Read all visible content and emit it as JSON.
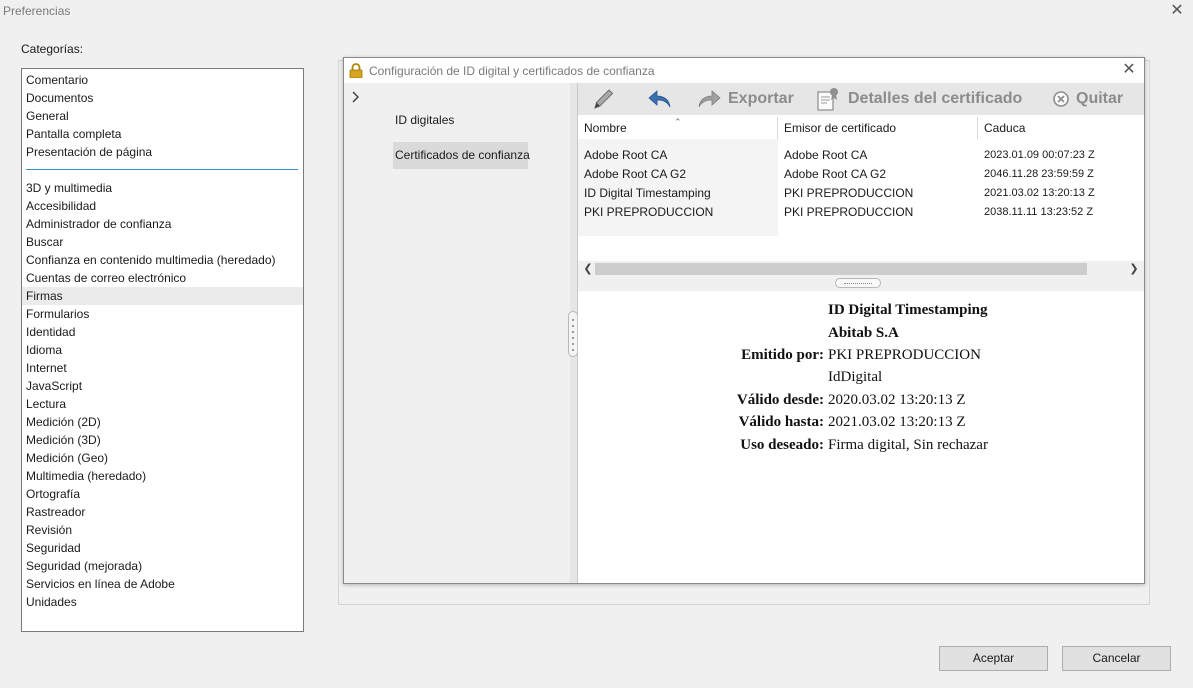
{
  "window": {
    "title": "Preferencias"
  },
  "categories": {
    "label": "Categorías:",
    "group1": [
      "Comentario",
      "Documentos",
      "General",
      "Pantalla completa",
      "Presentación de página"
    ],
    "group2": [
      "3D y multimedia",
      "Accesibilidad",
      "Administrador de confianza",
      "Buscar",
      "Confianza en contenido multimedia (heredado)",
      "Cuentas de correo electrónico",
      "Firmas",
      "Formularios",
      "Identidad",
      "Idioma",
      "Internet",
      "JavaScript",
      "Lectura",
      "Medición (2D)",
      "Medición (3D)",
      "Medición (Geo)",
      "Multimedia (heredado)",
      "Ortografía",
      "Rastreador",
      "Revisión",
      "Seguridad",
      "Seguridad (mejorada)",
      "Servicios en línea de Adobe",
      "Unidades"
    ],
    "selected": "Firmas"
  },
  "dialog": {
    "title": "Configuración de ID digital y certificados de confianza",
    "nav": {
      "item1": "ID digitales",
      "item2": "Certificados de confianza",
      "selected": "Certificados de confianza"
    },
    "toolbar": {
      "export_label": "Exportar",
      "details_label": "Detalles del certificado",
      "remove_label": "Quitar",
      "icon_color": "#8c8c8c",
      "import_icon_color": "#3a6fb0"
    },
    "table": {
      "headers": {
        "name": "Nombre",
        "issuer": "Emisor de certificado",
        "expires": "Caduca"
      },
      "rows": [
        {
          "name": "Adobe Root CA",
          "issuer": "Adobe Root CA",
          "expires": "2023.01.09 00:07:23 Z"
        },
        {
          "name": "Adobe Root CA G2",
          "issuer": "Adobe Root CA G2",
          "expires": "2046.11.28 23:59:59 Z"
        },
        {
          "name": "ID Digital Timestamping",
          "issuer": "PKI PREPRODUCCION",
          "expires": "2021.03.02 13:20:13 Z"
        },
        {
          "name": "PKI PREPRODUCCION",
          "issuer": "PKI PREPRODUCCION",
          "expires": "2038.11.11 13:23:52 Z"
        }
      ]
    },
    "details": {
      "name": "ID Digital Timestamping",
      "org": "Abitab S.A",
      "issued_by_label": "Emitido por:",
      "issued_by": "PKI PREPRODUCCION",
      "issued_by_org": "IdDigital",
      "valid_from_label": "Válido desde:",
      "valid_from": "2020.03.02 13:20:13 Z",
      "valid_to_label": "Válido hasta:",
      "valid_to": "2021.03.02 13:20:13 Z",
      "usage_label": "Uso deseado:",
      "usage": "Firma digital, Sin rechazar"
    }
  },
  "buttons": {
    "ok": "Aceptar",
    "cancel": "Cancelar"
  }
}
